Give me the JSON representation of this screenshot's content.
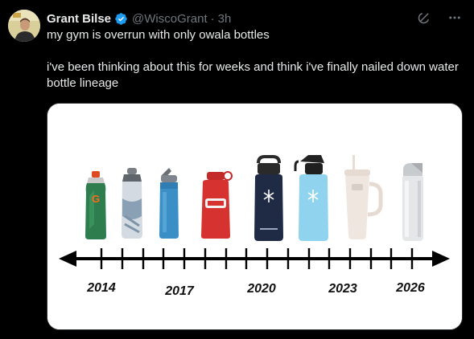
{
  "author": {
    "name": "Grant Bilse",
    "handle": "@WiscoGrant",
    "time": "3h",
    "separator": "·"
  },
  "post": {
    "line1": "my gym is overrun with only owala bottles",
    "line2": "i've been thinking about this for weeks and think i've finally nailed down water bottle lineage"
  },
  "timeline": {
    "years": [
      "2014",
      "2017",
      "2020",
      "2023",
      "2026"
    ],
    "bottles": [
      {
        "name": "gatorade-squeeze-bottle",
        "color": "#2e7d4f"
      },
      {
        "name": "camelbak-podium-bottle",
        "color": "#c9d2db"
      },
      {
        "name": "camelbak-eddy-bottle",
        "color": "#3a8fc6"
      },
      {
        "name": "nalgene-bottle",
        "color": "#d6322f"
      },
      {
        "name": "hydro-flask-navy",
        "color": "#1f2a44"
      },
      {
        "name": "hydro-flask-light-blue",
        "color": "#8fd3ee"
      },
      {
        "name": "stanley-quencher-tumbler",
        "color": "#efe6df"
      },
      {
        "name": "owala-bottle",
        "color": "#e4e6e8"
      }
    ]
  },
  "icons": {
    "verified": "verified-badge-icon",
    "grok": "grok-icon",
    "more": "more-icon"
  },
  "colors": {
    "background": "#000000",
    "text": "#e7e9ea",
    "muted": "#71767b",
    "verified": "#1d9bf0"
  }
}
